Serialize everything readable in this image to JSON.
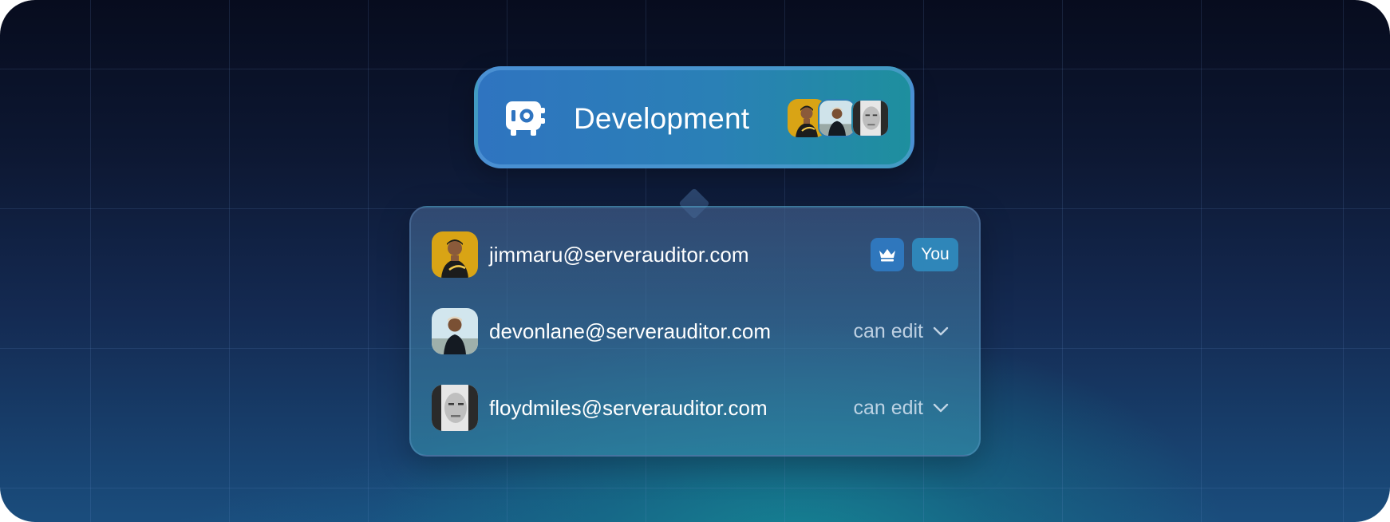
{
  "vault": {
    "title": "Development",
    "icon": "vault-icon",
    "shared_avatars": [
      "avatar-jimmaru",
      "avatar-devonlane",
      "avatar-floydmiles"
    ]
  },
  "members": [
    {
      "email": "jimmaru@serverauditor.com",
      "role_icon": "crown-icon",
      "tag": "You"
    },
    {
      "email": "devonlane@serverauditor.com",
      "permission": "can edit"
    },
    {
      "email": "floydmiles@serverauditor.com",
      "permission": "can edit"
    }
  ],
  "colors": {
    "background_top": "#070c1e",
    "background_bottom": "#1a4d7d",
    "card_left": "#2f74c0",
    "card_right": "#1e8f9e",
    "badge_blue": "#2f77bd"
  }
}
